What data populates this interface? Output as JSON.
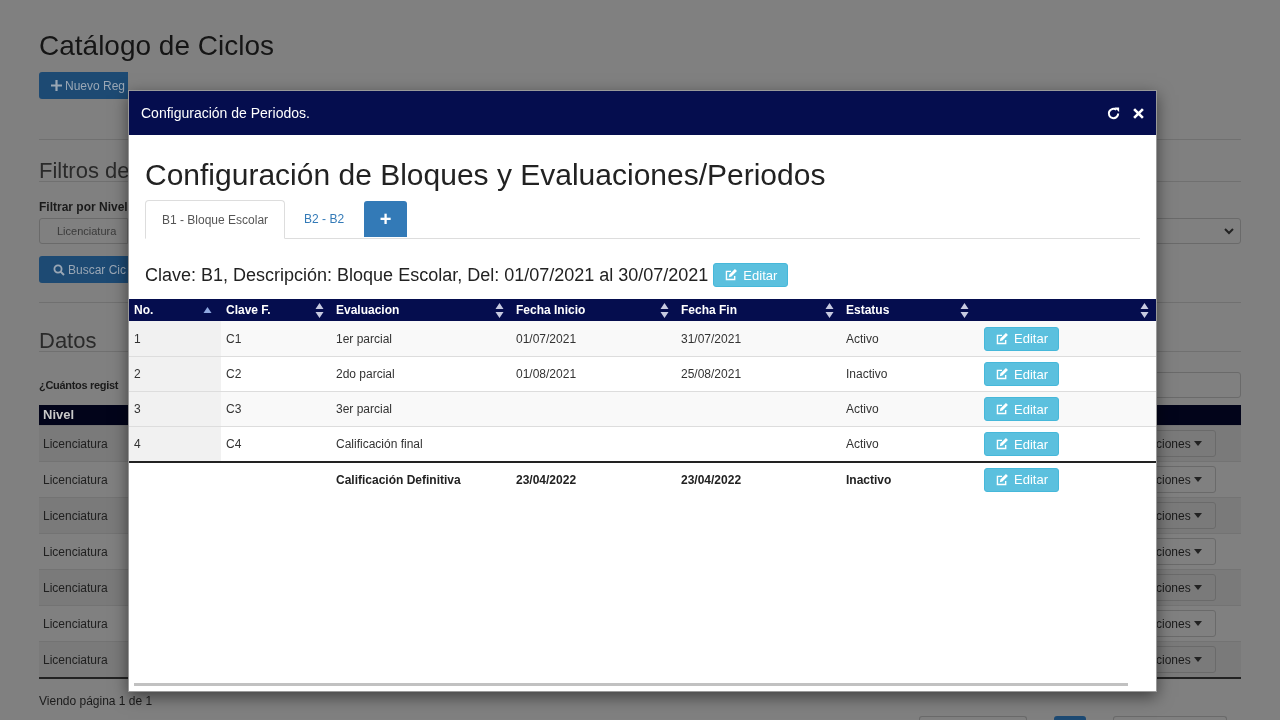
{
  "background_page": {
    "title": "Catálogo de Ciclos",
    "new_button": "Nuevo Reg",
    "filters_heading": "Filtros de",
    "filter_label": "Filtrar por Nivel",
    "filter_select": "Licenciatura",
    "search_button": "Buscar Cic",
    "data_heading": "Datos",
    "count_label": "¿Cuántos regist",
    "table_header": "Nivel",
    "rows": [
      {
        "nivel": "Licenciatura",
        "options": "ciones"
      },
      {
        "nivel": "Licenciatura",
        "options": "ciones"
      },
      {
        "nivel": "Licenciatura",
        "options": "ciones"
      },
      {
        "nivel": "Licenciatura",
        "options": "ciones"
      },
      {
        "nivel": "Licenciatura",
        "options": "ciones"
      },
      {
        "nivel": "Licenciatura",
        "options": "ciones"
      },
      {
        "nivel": "Licenciatura",
        "options": "ciones"
      }
    ],
    "pagination_text": "Viendo página 1 de 1"
  },
  "dialog": {
    "title": "Configuración de Periodos.",
    "heading": "Configuración de Bloques y Evaluaciones/Periodos",
    "tabs": [
      {
        "label": "B1 - Bloque Escolar",
        "selected": true
      },
      {
        "label": "B2 - B2",
        "selected": false
      }
    ],
    "add_tab_button": "+",
    "block_summary": "Clave: B1, Descripción: Bloque Escolar, Del: 01/07/2021 al 30/07/2021",
    "summary_button": "Editar",
    "table": {
      "columns": [
        {
          "label": "No.",
          "sorted": true
        },
        {
          "label": "Clave F.",
          "sorted": false
        },
        {
          "label": "Evaluacion",
          "sorted": false
        },
        {
          "label": "Fecha Inicio",
          "sorted": false
        },
        {
          "label": "Fecha Fin",
          "sorted": false
        },
        {
          "label": "Estatus",
          "sorted": false
        },
        {
          "sorted": false
        }
      ],
      "rows": [
        {
          "cells": [
            "1",
            "C1",
            "1er parcial",
            "01/07/2021",
            "31/07/2021",
            "Activo"
          ],
          "action": "Editar"
        },
        {
          "cells": [
            "2",
            "C2",
            "2do parcial",
            "01/08/2021",
            "25/08/2021",
            "Inactivo"
          ],
          "action": "Editar"
        },
        {
          "cells": [
            "3",
            "C3",
            "3er parcial",
            null,
            null,
            "Activo"
          ],
          "action": "Editar"
        },
        {
          "cells": [
            "4",
            "C4",
            "Calificación final",
            null,
            null,
            "Activo"
          ],
          "action": "Editar"
        }
      ],
      "footer": {
        "cells": [
          null,
          null,
          "Calificación Definitiva",
          "23/04/2022",
          "23/04/2022",
          "Inactivo"
        ],
        "action": "Editar"
      }
    }
  }
}
